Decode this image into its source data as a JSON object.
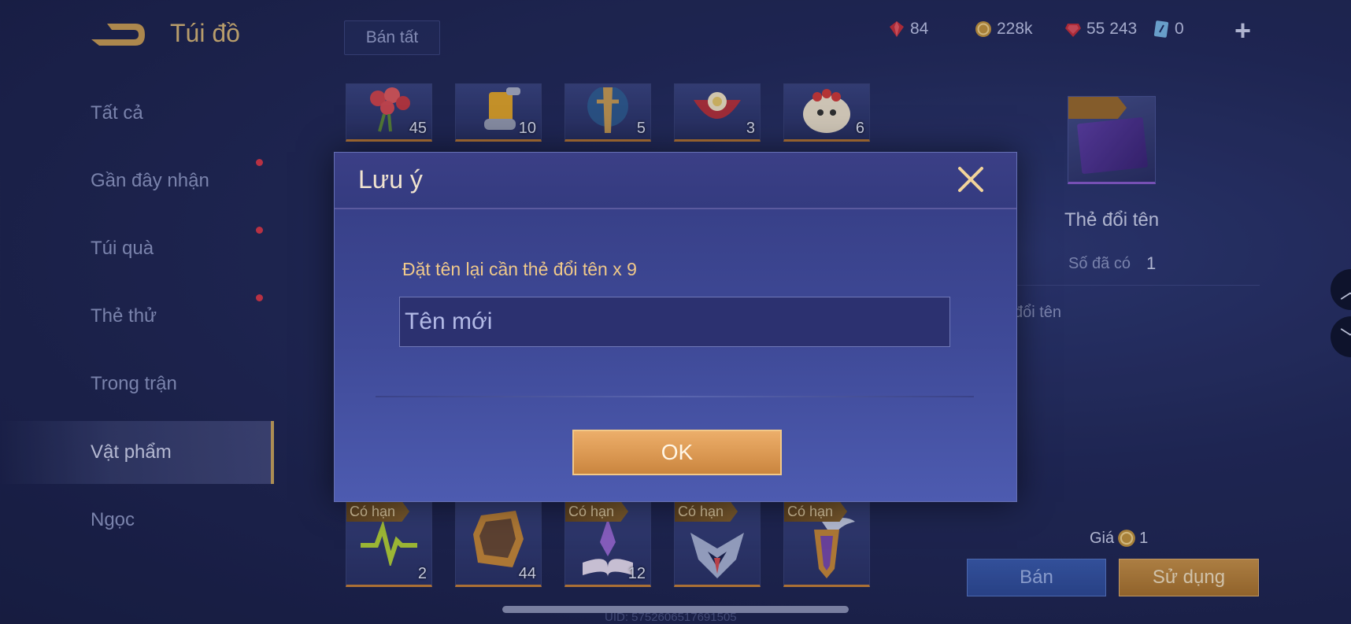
{
  "header": {
    "title": "Túi đồ",
    "sell_all_label": "Bán tất",
    "currencies": [
      {
        "name": "red-gem-icon",
        "value": "84",
        "color": "#d8384a"
      },
      {
        "name": "gold-coin-icon",
        "value": "228k",
        "color": "#d2a34e"
      },
      {
        "name": "ruby-icon",
        "value": "55 243",
        "color": "#d8384a"
      },
      {
        "name": "rename-card-icon",
        "value": "0",
        "color": "#7ab8e8"
      }
    ],
    "add_label": "+"
  },
  "sidebar": {
    "items": [
      {
        "label": "Tất cả",
        "badge": false
      },
      {
        "label": "Gần đây nhận",
        "badge": true
      },
      {
        "label": "Túi quà",
        "badge": true
      },
      {
        "label": "Thẻ thử",
        "badge": true
      },
      {
        "label": "Trong trận",
        "badge": false
      },
      {
        "label": "Vật phẩm",
        "badge": false,
        "active": true
      },
      {
        "label": "Ngọc",
        "badge": false
      }
    ]
  },
  "grid": {
    "top_row": [
      {
        "icon": "rose-bouquet-icon",
        "count": "45"
      },
      {
        "icon": "scroll-icon",
        "count": "10"
      },
      {
        "icon": "statue-icon",
        "count": "5"
      },
      {
        "icon": "gift-box-icon",
        "count": "3"
      },
      {
        "icon": "lion-mask-icon",
        "count": "6"
      }
    ],
    "bottom_row": [
      {
        "icon": "pulse-icon",
        "count": "2",
        "tag": "Có hạn"
      },
      {
        "icon": "hero-card-icon",
        "count": "44",
        "tag": ""
      },
      {
        "icon": "spellbook-icon",
        "count": "12",
        "tag": "Có hạn"
      },
      {
        "icon": "rank-emblem-icon",
        "count": "",
        "tag": "Có hạn"
      },
      {
        "icon": "wing-emblem-icon",
        "count": "",
        "tag": "Có hạn"
      }
    ]
  },
  "detail": {
    "name": "Thẻ đổi tên",
    "owned_label": "Số đã có",
    "owned_value": "1",
    "description": "đổi tên",
    "price_label": "Giá",
    "price_value": "1",
    "sell_label": "Bán",
    "use_label": "Sử dụng"
  },
  "footer": {
    "uid": "UID: 5752606517691505"
  },
  "dialog": {
    "title": "Lưu ý",
    "message": "Đặt tên lại cần thẻ đổi tên x 9",
    "input_placeholder": "Tên mới",
    "input_value": "",
    "ok_label": "OK"
  },
  "colors": {
    "accent_gold": "#d8b77a",
    "badge_red": "#d8384a",
    "ok_orange": "#d99650",
    "sell_blue": "#2e4a98"
  }
}
